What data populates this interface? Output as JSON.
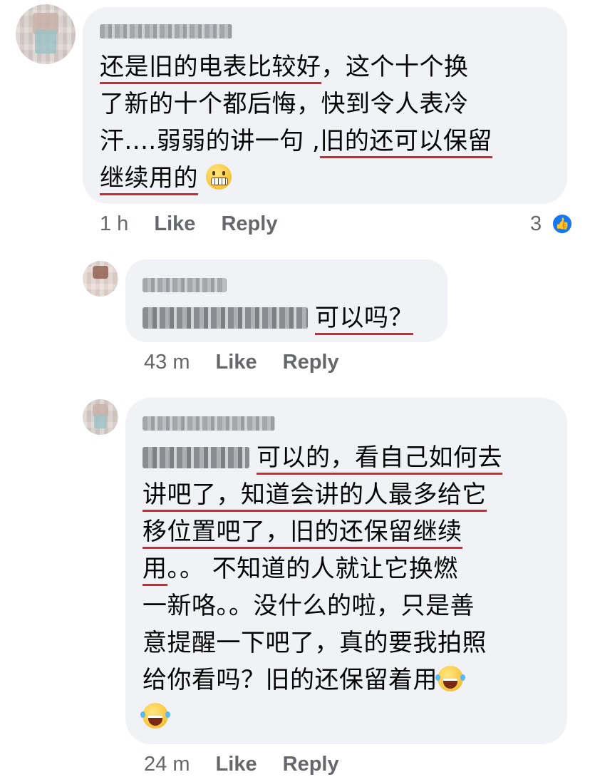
{
  "comments": [
    {
      "lines": [
        [
          {
            "t": "还是旧的电表比较好",
            "u": true
          },
          {
            "t": "，这个十个换"
          }
        ],
        [
          {
            "t": "了新的十个都后悔，快到令人表冷"
          }
        ],
        [
          {
            "t": "汗....弱弱的讲一句 ,"
          },
          {
            "t": "旧的还可以保留",
            "u": true
          }
        ],
        [
          {
            "t": "继续用的",
            "u": true
          },
          {
            "t": " "
          },
          {
            "emoji": "grimacing-emoji"
          }
        ]
      ],
      "time": "1 h",
      "like": "Like",
      "reply": "Reply",
      "reactions": "3"
    },
    {
      "lines": [
        [
          {
            "tag": true
          },
          {
            "t": "可以吗？",
            "u": true
          }
        ]
      ],
      "time": "43 m",
      "like": "Like",
      "reply": "Reply"
    },
    {
      "lines": [
        [
          {
            "tag": true
          },
          {
            "t": "可以的，看自己如何去",
            "u": true
          }
        ],
        [
          {
            "t": "讲吧了，知道会讲的人最多给它",
            "u": true
          }
        ],
        [
          {
            "t": "移位置吧了，旧的还保留继续",
            "u": true
          }
        ],
        [
          {
            "t": "用",
            "u": true
          },
          {
            "t": "。。 不知道的人就让它换燃"
          }
        ],
        [
          {
            "t": "一新咯。。没什么的啦，只是善"
          }
        ],
        [
          {
            "t": "意提醒一下吧了，真的要我拍照"
          }
        ],
        [
          {
            "t": "给你看吗？旧的还保留着用"
          },
          {
            "emoji": "laughing-emoji"
          }
        ],
        [
          {
            "emoji": "laughing-emoji"
          }
        ]
      ],
      "time": "24 m",
      "like": "Like",
      "reply": "Reply"
    }
  ],
  "colors": {
    "bubble": "#f0f2f5",
    "underline": "#d3282e",
    "meta": "#65676b",
    "like_badge": "#1877f2"
  }
}
